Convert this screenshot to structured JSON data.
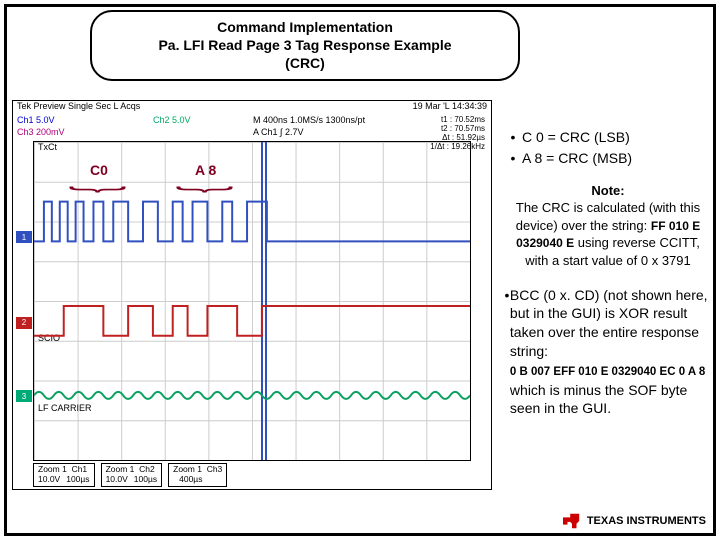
{
  "title": {
    "line1": "Command Implementation",
    "line2": "Pa. LFI Read Page 3 Tag Response Example",
    "line3": "(CRC)"
  },
  "scope": {
    "top_left": "Tek    Preview   Single Sec         L Acqs",
    "top_right": "19 Mar 'L  14:34:39",
    "ch1": "Ch1   5.0V",
    "ch3": "Ch3   200mV",
    "ch2": "Ch2   5.0V",
    "m_line": "M 400ns  1.0MS/s    1300ns/pt",
    "a_line": "A Ch1 ∫  2.7V",
    "cursor_t1_label": "t1 :",
    "cursor_t1_val": "70.52ms",
    "cursor_t2_label": "t2 :",
    "cursor_t2_val": "70.57ms",
    "cursor_dt_label": "Δt :",
    "cursor_dt_val": "51.92µs",
    "cursor_fdt_label": "1/Δt :",
    "cursor_fdt_val": "19.26kHz",
    "txct_label": "TxCt",
    "scio_label": "SCIO",
    "lf_label": "LF CARRIER",
    "marker1": "1",
    "marker2": "2",
    "marker3": "3",
    "zoom": [
      {
        "z": "Zoom 1",
        "ch": "Ch1",
        "scale": "10.0V",
        "t": "100µs"
      },
      {
        "z": "Zoom 1",
        "ch": "Ch2",
        "scale": "10.0V",
        "t": "100µs"
      },
      {
        "z": "Zoom 1",
        "ch": "Ch3",
        "scale": "",
        "t": "400µs"
      }
    ]
  },
  "overlays": {
    "c0": "C0",
    "a8": "A 8"
  },
  "side": {
    "b1": "C 0 = CRC (LSB)",
    "b2": "A 8 = CRC (MSB)",
    "note_heading": "Note:",
    "note_body1": "The CRC is calculated (with this device) over the string:",
    "note_hex": "FF 010 E 0329040 E",
    "note_body2": " using reverse CCITT, with a start value of 0 x 3791",
    "b3a": "BCC (0 x. CD) (not shown here, but in the GUI) is XOR result taken over the entire response string:",
    "b3hex": "0 B 007 EFF 010 E 0329040 EC 0 A 8",
    "b3b": "which is minus the SOF byte seen in the GUI."
  },
  "logo": {
    "text": "TEXAS INSTRUMENTS"
  },
  "chart_data": {
    "type": "oscilloscope-capture",
    "channels": [
      {
        "name": "Ch1 / TxCt",
        "color": "#3050c0",
        "scale": "5.0V",
        "desc": "digital pulse train, upper trace"
      },
      {
        "name": "Ch2 / SCIO",
        "color": "#c02020",
        "scale": "5.0V",
        "desc": "digital pulse train, middle trace"
      },
      {
        "name": "Ch3 / LF CARRIER",
        "color": "#0aa060",
        "scale": "200mV",
        "desc": "continuous low-amplitude carrier, lower trace"
      }
    ],
    "timebase": "M 400ns, 1.0MS/s, 1300ns/pt",
    "cursors": {
      "t1": "70.52ms",
      "t2": "70.57ms",
      "delta_t": "51.92µs",
      "inv_delta_t": "19.26kHz"
    },
    "annotated_bytes": [
      {
        "label": "C0",
        "meaning": "CRC LSB",
        "value_hex": "0xC0"
      },
      {
        "label": "A8",
        "meaning": "CRC MSB",
        "value_hex": "0xA8"
      }
    ],
    "zoom_windows": [
      {
        "ch": "Ch1",
        "v": "10.0V",
        "t": "100µs"
      },
      {
        "ch": "Ch2",
        "v": "10.0V",
        "t": "100µs"
      },
      {
        "ch": "Ch3",
        "v": "",
        "t": "400µs"
      }
    ]
  }
}
